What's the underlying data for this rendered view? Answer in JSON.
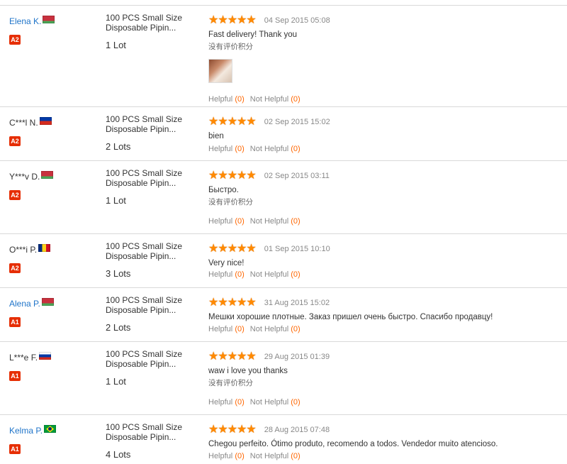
{
  "reviews": [
    {
      "buyer": "Elena K.",
      "name_style": "link",
      "flag": "by-flag",
      "badge": "A2",
      "product_title": "100 PCS Small Size Disposable Pipin...",
      "quantity": "1 Lot",
      "rating": 5,
      "date": "04 Sep 2015 05:08",
      "comment": "Fast delivery! Thank you",
      "no_score": "没有评价积分",
      "has_photo": true,
      "helpful_label": "Helpful",
      "helpful_count": "(0)",
      "not_helpful_label": "Not Helpful",
      "not_helpful_count": "(0)"
    },
    {
      "buyer": "C***l N.",
      "name_style": "plain",
      "flag": "cl-flag",
      "badge": "A2",
      "product_title": "100 PCS Small Size Disposable Pipin...",
      "quantity": "2 Lots",
      "rating": 5,
      "date": "02 Sep 2015 15:02",
      "comment": "bien",
      "no_score": "",
      "has_photo": false,
      "helpful_label": "Helpful",
      "helpful_count": "(0)",
      "not_helpful_label": "Not Helpful",
      "not_helpful_count": "(0)"
    },
    {
      "buyer": "Y***v D.",
      "name_style": "plain",
      "flag": "by-flag",
      "badge": "A2",
      "product_title": "100 PCS Small Size Disposable Pipin...",
      "quantity": "1 Lot",
      "rating": 5,
      "date": "02 Sep 2015 03:11",
      "comment": "Быстро.",
      "no_score": "没有评价积分",
      "has_photo": false,
      "helpful_label": "Helpful",
      "helpful_count": "(0)",
      "not_helpful_label": "Not Helpful",
      "not_helpful_count": "(0)"
    },
    {
      "buyer": "O***i P.",
      "name_style": "plain",
      "flag": "ro-flag",
      "badge": "A2",
      "product_title": "100 PCS Small Size Disposable Pipin...",
      "quantity": "3 Lots",
      "rating": 5,
      "date": "01 Sep 2015 10:10",
      "comment": "Very nice!",
      "no_score": "",
      "has_photo": false,
      "helpful_label": "Helpful",
      "helpful_count": "(0)",
      "not_helpful_label": "Not Helpful",
      "not_helpful_count": "(0)"
    },
    {
      "buyer": "Alena P.",
      "name_style": "link",
      "flag": "by-flag",
      "badge": "A1",
      "product_title": "100 PCS Small Size Disposable Pipin...",
      "quantity": "2 Lots",
      "rating": 5,
      "date": "31 Aug 2015 15:02",
      "comment": "Мешки хорошие плотные. Заказ пришел очень быстро. Спасибо продавцу!",
      "no_score": "",
      "has_photo": false,
      "helpful_label": "Helpful",
      "helpful_count": "(0)",
      "not_helpful_label": "Not Helpful",
      "not_helpful_count": "(0)"
    },
    {
      "buyer": "L***e F.",
      "name_style": "plain",
      "flag": "ru-flag",
      "badge": "A1",
      "product_title": "100 PCS Small Size Disposable Pipin...",
      "quantity": "1 Lot",
      "rating": 5,
      "date": "29 Aug 2015 01:39",
      "comment": "waw i love you thanks",
      "no_score": "没有评价积分",
      "has_photo": false,
      "helpful_label": "Helpful",
      "helpful_count": "(0)",
      "not_helpful_label": "Not Helpful",
      "not_helpful_count": "(0)"
    },
    {
      "buyer": "Kelma P.",
      "name_style": "link",
      "flag": "br-flag",
      "badge": "A1",
      "product_title": "100 PCS Small Size Disposable Pipin...",
      "quantity": "4 Lots",
      "rating": 5,
      "date": "28 Aug 2015 07:48",
      "comment": "Chegou perfeito. Ótimo produto, recomendo a todos. Vendedor muito atencioso.",
      "no_score": "",
      "has_photo": false,
      "helpful_label": "Helpful",
      "helpful_count": "(0)",
      "not_helpful_label": "Not Helpful",
      "not_helpful_count": "(0)"
    }
  ],
  "colors": {
    "buyer_link": "#1f74c9",
    "star": "#ff8a00",
    "badge": "#e62e04",
    "vote_count": "#ff6600",
    "divider": "#d9d9d9"
  }
}
